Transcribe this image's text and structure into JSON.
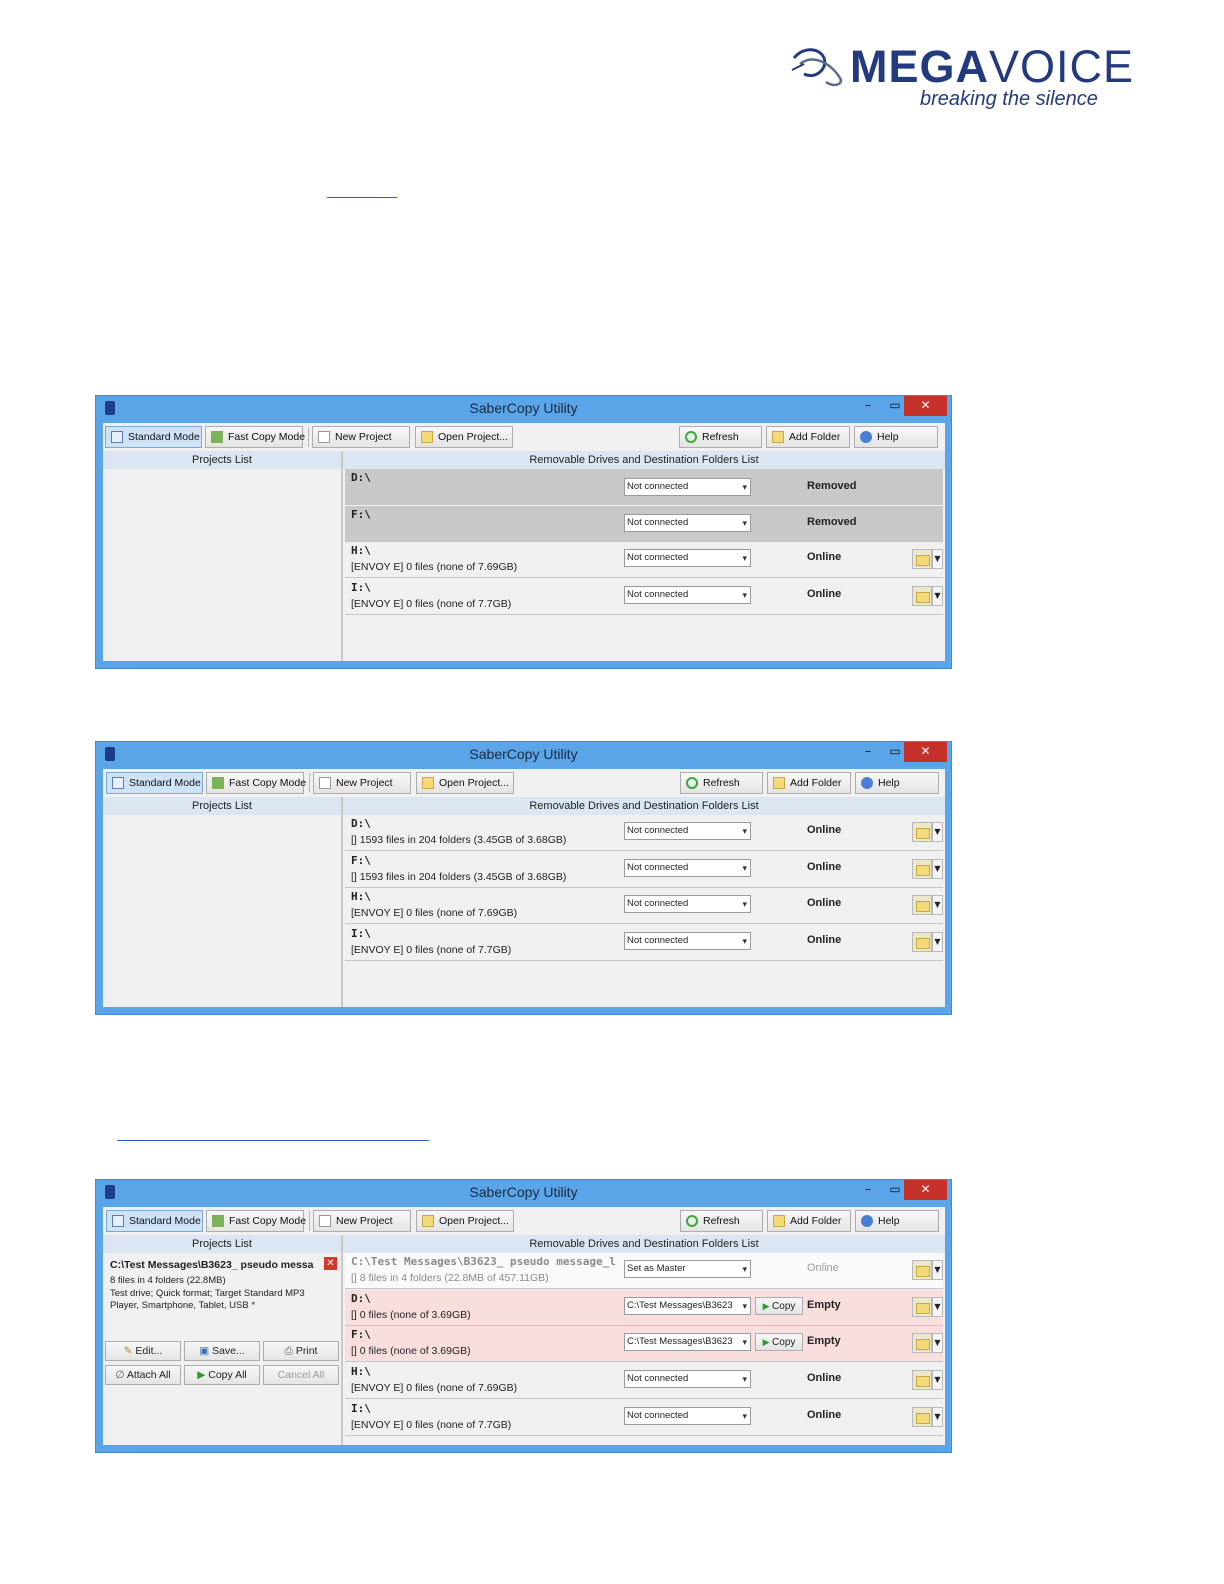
{
  "logo": {
    "brand_mega": "MEGA",
    "brand_voice": "VOICE",
    "tagline": "breaking the silence"
  },
  "window_title": "SaberCopy Utility",
  "window_controls": {
    "minimize": "–",
    "maximize": "▭",
    "close": "✕"
  },
  "toolbar": {
    "standard_mode": "Standard Mode",
    "fast_copy_mode": "Fast Copy Mode",
    "new_project": "New Project",
    "open_project": "Open Project...",
    "refresh": "Refresh",
    "add_folder": "Add Folder",
    "help": "Help"
  },
  "headers": {
    "projects_list": "Projects List",
    "drives_list": "Removable Drives and Destination Folders List"
  },
  "window1": {
    "rows": [
      {
        "name": "D:\\",
        "info": "",
        "select": "Not connected",
        "status": "Removed"
      },
      {
        "name": "F:\\",
        "info": "",
        "select": "Not connected",
        "status": "Removed"
      },
      {
        "name": "H:\\",
        "info": "[ENVOY E] 0 files (none of 7.69GB)",
        "select": "Not connected",
        "status": "Online"
      },
      {
        "name": "I:\\",
        "info": "[ENVOY E] 0 files (none of 7.7GB)",
        "select": "Not connected",
        "status": "Online"
      }
    ]
  },
  "window2": {
    "rows": [
      {
        "name": "D:\\",
        "info": "[] 1593 files in 204 folders (3.45GB of 3.68GB)",
        "select": "Not connected",
        "status": "Online"
      },
      {
        "name": "F:\\",
        "info": "[] 1593 files in 204 folders (3.45GB of 3.68GB)",
        "select": "Not connected",
        "status": "Online"
      },
      {
        "name": "H:\\",
        "info": "[ENVOY E] 0 files (none of 7.69GB)",
        "select": "Not connected",
        "status": "Online"
      },
      {
        "name": "I:\\",
        "info": "[ENVOY E] 0 files (none of 7.7GB)",
        "select": "Not connected",
        "status": "Online"
      }
    ]
  },
  "window3": {
    "project": {
      "title": "C:\\Test Messages\\B3623_ pseudo messa",
      "line1": "8 files in 4 folders (22.8MB)",
      "line2": "Test drive; Quick format; Target Standard MP3",
      "line3": "Player, Smartphone, Tablet, USB *",
      "edit": "Edit...",
      "save": "Save...",
      "print": "Print",
      "attach_all": "Attach All",
      "copy_all": "Copy All",
      "cancel_all": "Cancel All"
    },
    "rows": [
      {
        "name": "C:\\Test Messages\\B3623_ pseudo message_l",
        "info": "[] 8 files in 4 folders (22.8MB of 457.11GB)",
        "select": "Set as Master",
        "status": "Online"
      },
      {
        "name": "D:\\",
        "info": "[] 0 files (none of 3.69GB)",
        "select": "C:\\Test Messages\\B3623",
        "copy": "Copy",
        "status": "Empty"
      },
      {
        "name": "F:\\",
        "info": "[] 0 files (none of 3.69GB)",
        "select": "C:\\Test Messages\\B3623",
        "copy": "Copy",
        "status": "Empty"
      },
      {
        "name": "H:\\",
        "info": "[ENVOY E] 0 files (none of 7.69GB)",
        "select": "Not connected",
        "status": "Online"
      },
      {
        "name": "I:\\",
        "info": "[ENVOY E] 0 files (none of 7.7GB)",
        "select": "Not connected",
        "status": "Online"
      }
    ]
  }
}
